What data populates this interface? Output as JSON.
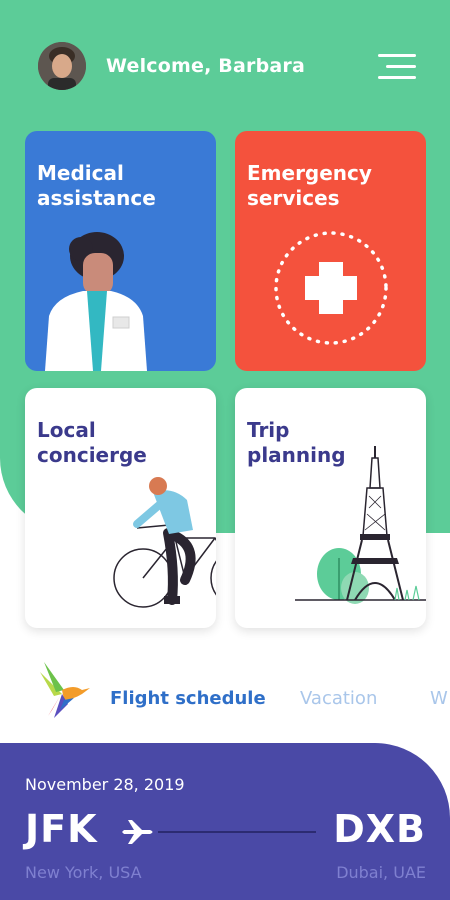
{
  "header": {
    "welcome_text": "Welcome, Barbara",
    "avatar_alt": "user avatar",
    "menu_icon": "hamburger-menu-icon"
  },
  "cards": [
    {
      "title": "Medical\nassistance",
      "color": "#3a7ad6",
      "icon": "doctor-illustration"
    },
    {
      "title": "Emergency\nservices",
      "color": "#f4523d",
      "icon": "medical-cross-icon"
    },
    {
      "title": "Local\nconcierge",
      "color": "#ffffff",
      "icon": "cyclist-illustration"
    },
    {
      "title": "Trip\nplanning",
      "color": "#ffffff",
      "icon": "eiffel-tower-illustration"
    }
  ],
  "tabs": [
    "Flight schedule",
    "Vacation",
    "W"
  ],
  "flight": {
    "date": "November 28, 2019",
    "from_code": "JFK",
    "from_city": "New York, USA",
    "to_code": "DXB",
    "to_city": "Dubai, UAE"
  },
  "colors": {
    "green": "#5ccc98",
    "navy": "#4a49a6",
    "blue_accent": "#2f6fc8",
    "title_navy": "#3b3a8c"
  }
}
